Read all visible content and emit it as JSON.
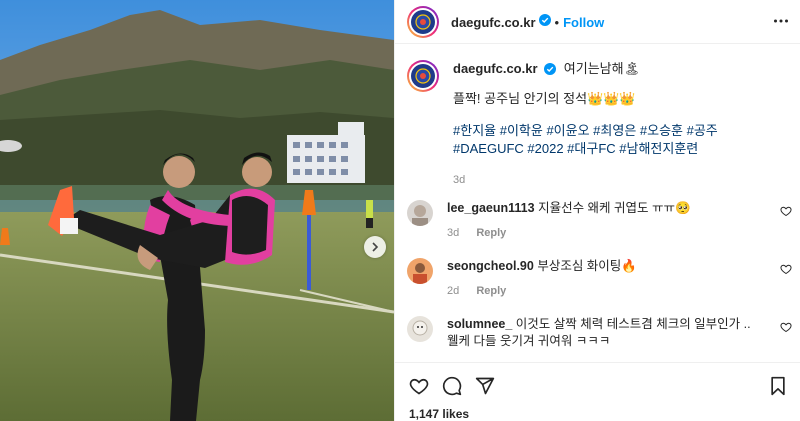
{
  "post": {
    "username": "daegufc.co.kr",
    "follow_label": "Follow",
    "dot": "•",
    "caption_line1": "여기는남해🏝",
    "caption_line2": "플짝! 공주님 안기의 정석👑👑👑",
    "hashtags": "#한지율 #이학윤 #이윤오 #최영은 #오승훈 #공주 #DAEGUFC #2022 #대구FC #남해전지훈련",
    "caption_time": "3d",
    "likes": "1,147 likes"
  },
  "comments": [
    {
      "username": "lee_gaeun1113",
      "text": "지율선수 왜케 귀엽도 ㅠㅠ🥺",
      "time": "3d",
      "reply": "Reply"
    },
    {
      "username": "seongcheol.90",
      "text": "부상조심 화이팅🔥",
      "time": "2d",
      "reply": "Reply"
    },
    {
      "username": "solumnee_",
      "text": "이것도 살짝 체력 테스트겸 체크의 일부인가 .. 웰케 다들 웃기겨 귀여워 ㅋㅋㅋ",
      "time": "",
      "reply": ""
    }
  ],
  "colors": {
    "link": "#0095f6",
    "hashtag": "#00376b",
    "muted": "#8e8e8e",
    "pink": "#e0399a"
  },
  "icons": [
    "verified-badge-icon",
    "more-options-icon",
    "heart-icon",
    "comment-icon",
    "share-icon",
    "bookmark-icon",
    "next-arrow-icon"
  ]
}
